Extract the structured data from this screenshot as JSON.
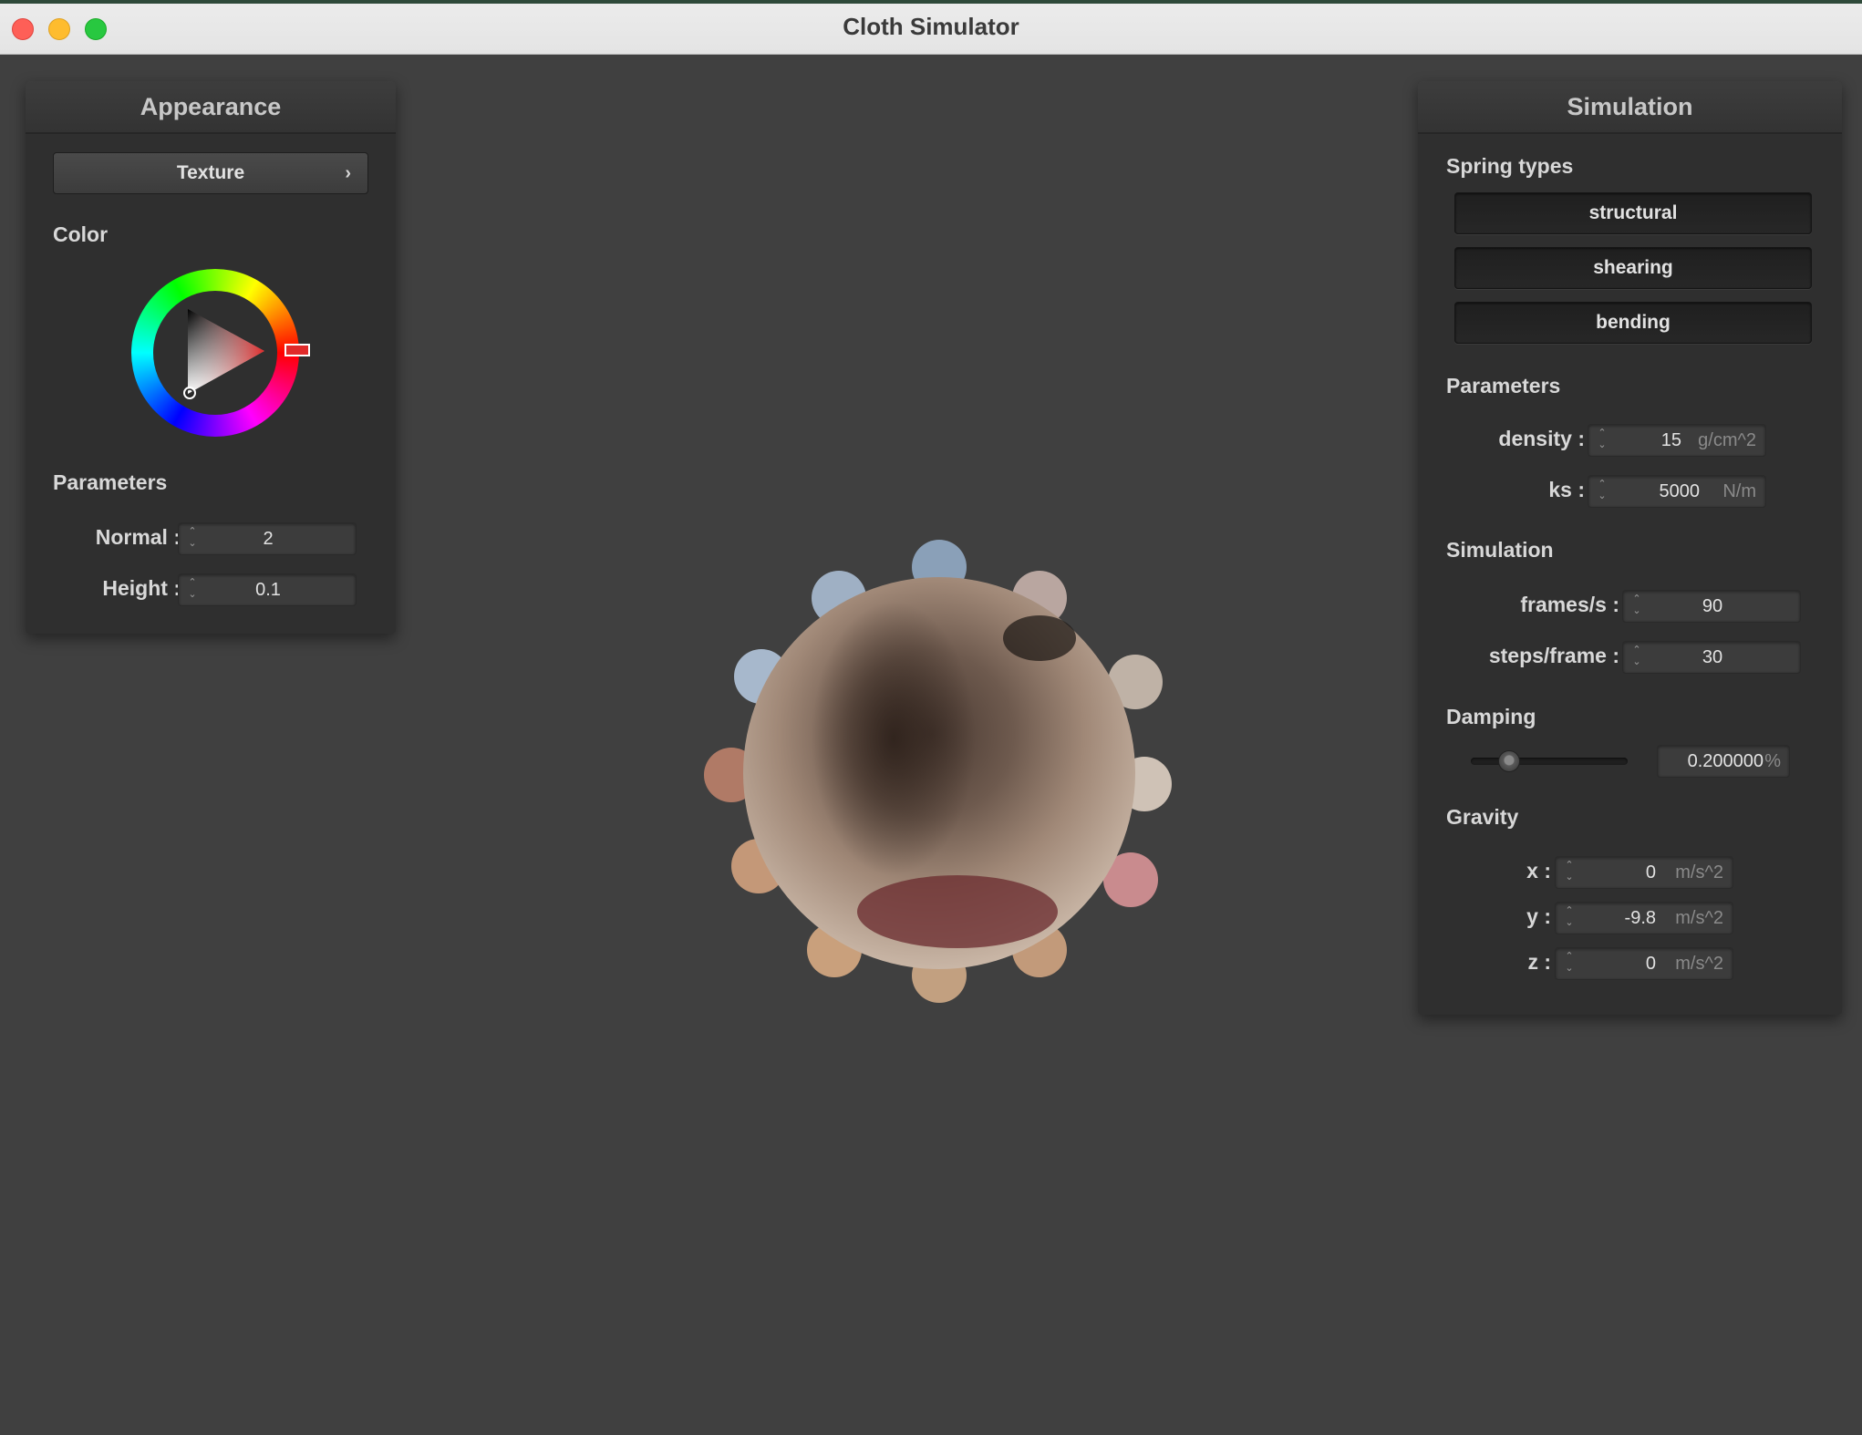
{
  "window": {
    "title": "Cloth Simulator"
  },
  "appearance": {
    "header": "Appearance",
    "texture_button": "Texture",
    "texture_chevron": "›",
    "color_label": "Color",
    "color_hex": "#e02a2a",
    "parameters_label": "Parameters",
    "normal": {
      "label": "Normal :",
      "value": "2"
    },
    "height": {
      "label": "Height :",
      "value": "0.1"
    }
  },
  "simulation": {
    "header": "Simulation",
    "spring_types_label": "Spring types",
    "springs": [
      "structural",
      "shearing",
      "bending"
    ],
    "parameters_label": "Parameters",
    "density": {
      "label": "density :",
      "value": "15",
      "unit": "g/cm^2"
    },
    "ks": {
      "label": "ks :",
      "value": "5000",
      "unit": "N/m"
    },
    "sim_label": "Simulation",
    "fps": {
      "label": "frames/s :",
      "value": "90"
    },
    "steps": {
      "label": "steps/frame :",
      "value": "30"
    },
    "damping_label": "Damping",
    "damping": {
      "value": "0.200000",
      "unit": "%",
      "slider_fraction": 0.2
    },
    "gravity_label": "Gravity",
    "gx": {
      "label": "x :",
      "value": "0",
      "unit": "m/s^2"
    },
    "gy": {
      "label": "y :",
      "value": "-9.8",
      "unit": "m/s^2"
    },
    "gz": {
      "label": "z :",
      "value": "0",
      "unit": "m/s^2"
    }
  },
  "colors": {
    "background": "#404040",
    "panel": "#2f2f2f",
    "accent_red": "#e02a2a"
  }
}
